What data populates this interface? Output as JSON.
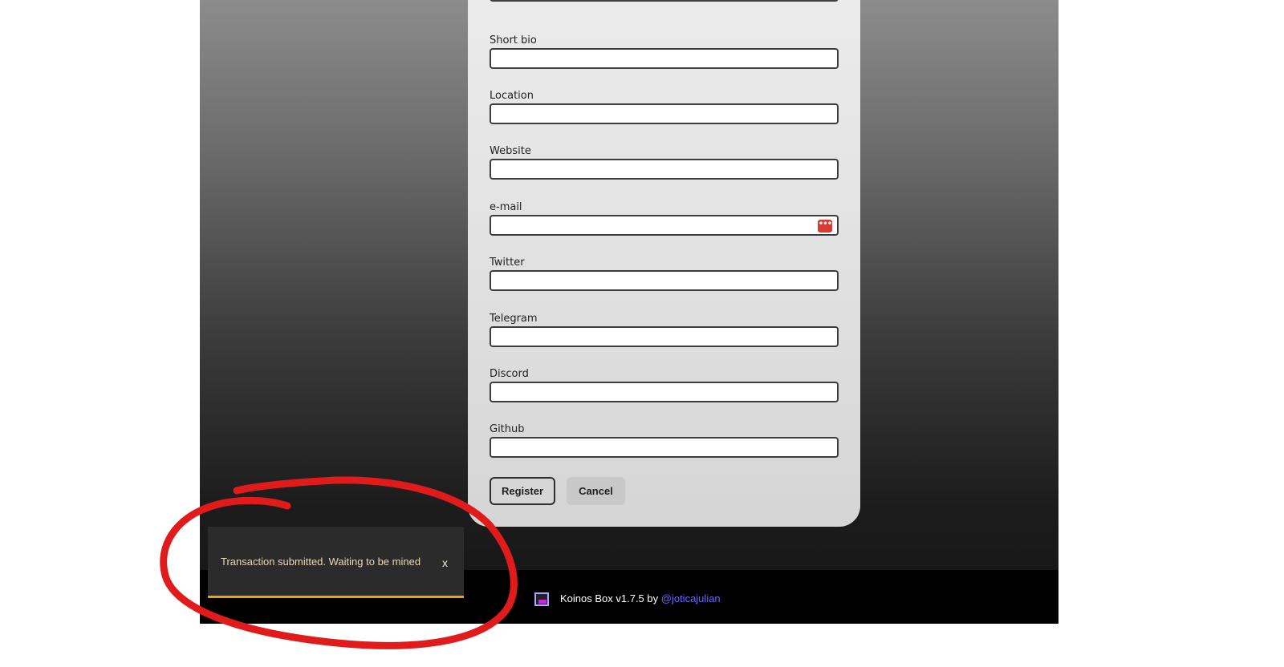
{
  "form": {
    "fields": [
      {
        "label": "Short bio",
        "value": ""
      },
      {
        "label": "Location",
        "value": ""
      },
      {
        "label": "Website",
        "value": ""
      },
      {
        "label": "e-mail",
        "value": ""
      },
      {
        "label": "Twitter",
        "value": ""
      },
      {
        "label": "Telegram",
        "value": ""
      },
      {
        "label": "Discord",
        "value": ""
      },
      {
        "label": "Github",
        "value": ""
      }
    ],
    "register_label": "Register",
    "cancel_label": "Cancel",
    "password_manager_icon": "password-manager-icon",
    "password_manager_glyph": "•••"
  },
  "footer": {
    "app_text": "Koinos Box v1.7.5 by ",
    "author_link": "@joticajulian",
    "link_color": "#6c63ff"
  },
  "toast": {
    "message": "Transaction submitted. Waiting to be mined",
    "close_label": "x",
    "accent_color": "#e8a21d"
  },
  "annotation": {
    "color": "#e01b1b"
  }
}
